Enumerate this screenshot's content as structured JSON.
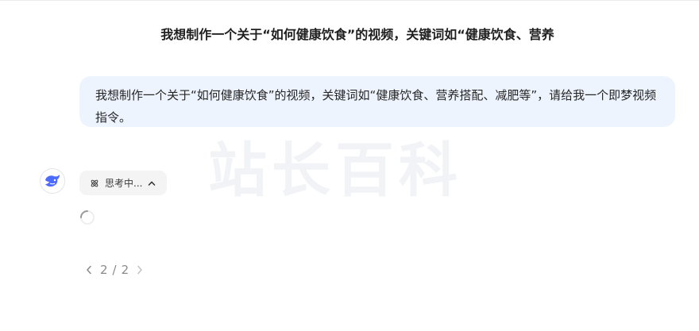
{
  "conversation": {
    "title": "我想制作一个关于“如何健康饮食”的视频，关键词如“健康饮食、营养"
  },
  "watermark": {
    "text": "站长百科"
  },
  "user_message": {
    "text": "我想制作一个关于“如何健康饮食”的视频，关键词如“健康饮食、营养搭配、减肥等”，请给我一个即梦视频指令。"
  },
  "assistant": {
    "avatar_icon": "deepseek-whale-icon",
    "thinking_label": "思考中...",
    "thinking_icon": "atom-icon",
    "toggle_icon": "chevron-up-icon",
    "loading_icon": "spinner-icon"
  },
  "pager": {
    "current": "2",
    "total": "2",
    "separator": "/"
  },
  "colors": {
    "user_bubble_bg": "#eef4fe",
    "chip_bg": "#f4f4f5",
    "brand_blue": "#4d6bfe"
  }
}
